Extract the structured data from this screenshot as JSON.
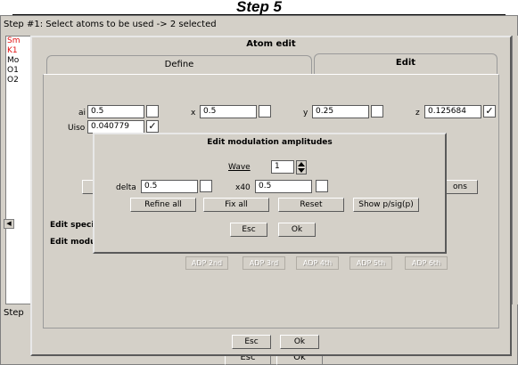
{
  "caption": "Step 5",
  "main": {
    "step_text": "Step #1: Select atoms to be used  -> 2 selected",
    "atom_list": [
      {
        "label": "Sm",
        "color": "#e01010"
      },
      {
        "label": "K1",
        "color": "#e01010"
      },
      {
        "label": "Mo",
        "color": "#000000"
      },
      {
        "label": "O1",
        "color": "#000000"
      },
      {
        "label": "O2",
        "color": "#000000"
      }
    ],
    "step_text_2": "Step",
    "esc_label": "Esc",
    "ok_label": "Ok"
  },
  "atom_edit": {
    "title": "Atom edit",
    "tabs": {
      "define": "Define",
      "edit": "Edit"
    },
    "fields": {
      "ai": {
        "label": "ai",
        "value": "0.5",
        "checked": false
      },
      "x": {
        "label": "x",
        "value": "0.5",
        "checked": false
      },
      "y": {
        "label": "y",
        "value": "0.25",
        "checked": false
      },
      "z": {
        "label": "z",
        "value": "0.125684",
        "checked": true
      },
      "uiso": {
        "label": "Uiso",
        "value": "0.040779",
        "checked": true
      }
    },
    "options_btn": "ons",
    "sections": {
      "special": "Edit speci",
      "modu": "Edit modu"
    },
    "adp_buttons": [
      "ADP 2nd",
      "ADP 3rd",
      "ADP 4th",
      "ADP 5th",
      "ADP 6th"
    ],
    "esc_label": "Esc",
    "ok_label": "Ok"
  },
  "modulation": {
    "title": "Edit modulation amplitudes",
    "wave_label": "Wave",
    "wave_value": "1",
    "delta_label": "delta",
    "delta_value": "0.5",
    "x40_label": "x40",
    "x40_value": "0.5",
    "buttons": {
      "refine_all": "Refine all",
      "fix_all": "Fix all",
      "reset": "Reset",
      "show_psig": "Show p/sig(p)"
    },
    "esc_label": "Esc",
    "ok_label": "Ok"
  }
}
